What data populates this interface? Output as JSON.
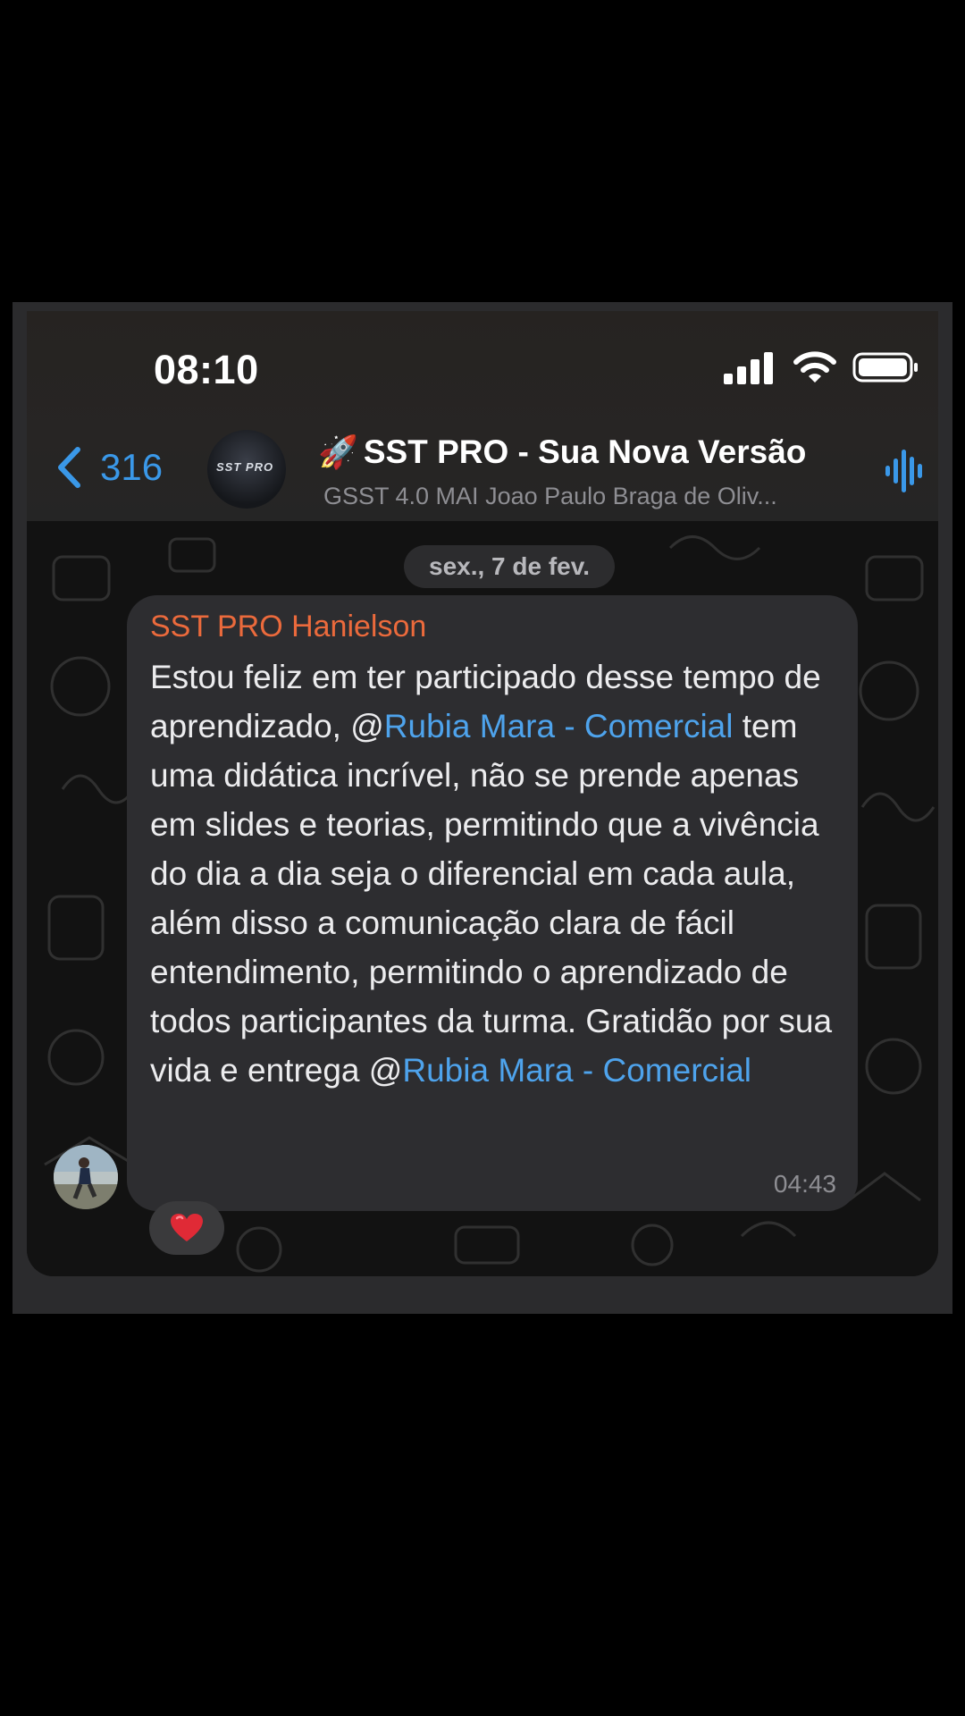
{
  "status_bar": {
    "time": "08:10"
  },
  "header": {
    "back_count": "316",
    "title_emoji": "🚀",
    "title": "SST PRO - Sua Nova Versão",
    "subtitle": "GSST 4.0 MAI Joao Paulo Braga de Oliv...",
    "avatar_text": "SST PRO"
  },
  "chat": {
    "date": "sex., 7 de fev.",
    "message": {
      "sender": "SST PRO Hanielson",
      "text_part1": "Estou feliz em ter participado desse tempo de aprendizado, ",
      "at1": "@",
      "mention1": "Rubia Mara - Comercial",
      "text_part2": " tem uma didática incrível, não se prende apenas em slides e teorias, permitindo que a vivência do dia a dia seja o diferencial em cada aula, além disso a comunicação clara de fácil entendimento, permitindo o aprendizado de todos participantes da turma. Gratidão por sua vida e entrega ",
      "at2": "@",
      "mention2": "Rubia Mara - Comercial",
      "time": "04:43"
    },
    "reaction": "❤️"
  },
  "colors": {
    "accent": "#3a98e8",
    "sender": "#eb6a3c",
    "mention": "#4ea3ec",
    "bubble": "#2d2d30"
  },
  "icons": [
    "back-chevron-icon",
    "signal-icon",
    "wifi-icon",
    "battery-icon",
    "voice-chat-icon",
    "heart-icon"
  ]
}
